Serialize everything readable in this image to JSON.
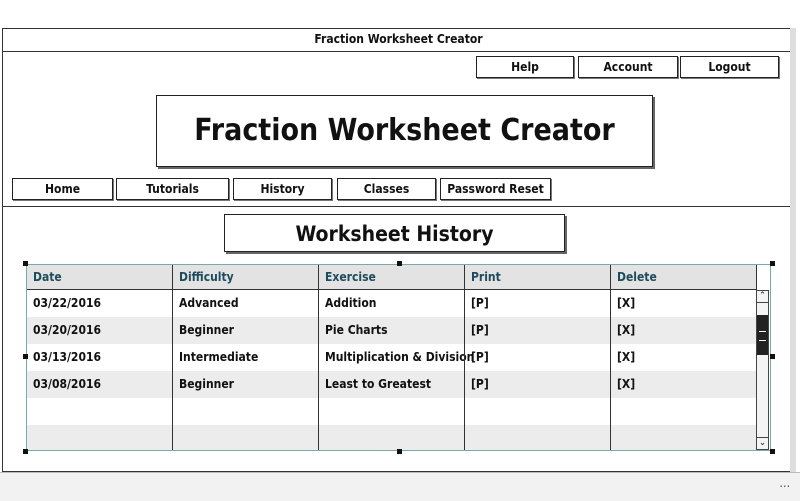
{
  "window": {
    "title": "Fraction Worksheet Creator"
  },
  "topnav": {
    "help": "Help",
    "account": "Account",
    "logout": "Logout"
  },
  "logo": {
    "title": "Fraction Worksheet Creator"
  },
  "nav": {
    "home": "Home",
    "tutorials": "Tutorials",
    "history": "History",
    "classes": "Classes",
    "password_reset": "Password Reset"
  },
  "section": {
    "title": "Worksheet History"
  },
  "table": {
    "headers": [
      "Date",
      "Difficulty",
      "Exercise",
      "Print",
      "Delete"
    ],
    "rows": [
      [
        "03/22/2016",
        "Advanced",
        "Addition",
        "[P]",
        "[X]"
      ],
      [
        "03/20/2016",
        "Beginner",
        "Pie Charts",
        "[P]",
        "[X]"
      ],
      [
        "03/13/2016",
        "Intermediate",
        "Multiplication & Division",
        "[P]",
        "[X]"
      ],
      [
        "03/08/2016",
        "Beginner",
        "Least to Greatest",
        "[P]",
        "[X]"
      ]
    ]
  },
  "scrollbar": {
    "up_icon": "chevron-up",
    "down_icon": "chevron-down"
  }
}
